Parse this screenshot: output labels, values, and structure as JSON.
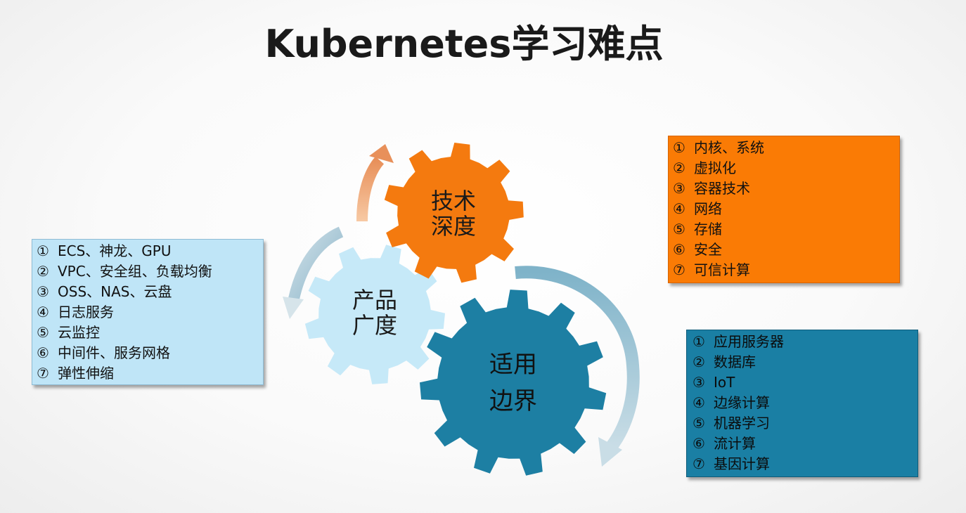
{
  "title": "Kubernetes学习难点",
  "gears": {
    "product": {
      "line1": "产品",
      "line2": "广度",
      "color": "#c6e9f8",
      "text_color": "#1a1a1a"
    },
    "tech": {
      "line1": "技术",
      "line2": "深度",
      "color": "#f47a0f",
      "text_color": "#1a1a1a"
    },
    "scope": {
      "line1": "适用",
      "line2": "边界",
      "color": "#1d7fa3",
      "text_color": "#111111"
    }
  },
  "lists": {
    "product": {
      "color": "#bfe5f7",
      "items": [
        {
          "num": "①",
          "text": "ECS、神龙、GPU"
        },
        {
          "num": "②",
          "text": "VPC、安全组、负载均衡"
        },
        {
          "num": "③",
          "text": "OSS、NAS、云盘"
        },
        {
          "num": "④",
          "text": "日志服务"
        },
        {
          "num": "⑤",
          "text": "云监控"
        },
        {
          "num": "⑥",
          "text": "中间件、服务网格"
        },
        {
          "num": "⑦",
          "text": "弹性伸缩"
        }
      ]
    },
    "tech": {
      "color": "#fa7b05",
      "items": [
        {
          "num": "①",
          "text": "内核、系统"
        },
        {
          "num": "②",
          "text": "虚拟化"
        },
        {
          "num": "③",
          "text": "容器技术"
        },
        {
          "num": "④",
          "text": "网络"
        },
        {
          "num": "⑤",
          "text": "存储"
        },
        {
          "num": "⑥",
          "text": "安全"
        },
        {
          "num": "⑦",
          "text": "可信计算"
        }
      ]
    },
    "scope": {
      "color": "#1a7fa4",
      "items": [
        {
          "num": "①",
          "text": "应用服务器"
        },
        {
          "num": "②",
          "text": "数据库"
        },
        {
          "num": "③",
          "text": "IoT"
        },
        {
          "num": "④",
          "text": "边缘计算"
        },
        {
          "num": "⑤",
          "text": "机器学习"
        },
        {
          "num": "⑥",
          "text": "流计算"
        },
        {
          "num": "⑦",
          "text": "基因计算"
        }
      ]
    }
  }
}
